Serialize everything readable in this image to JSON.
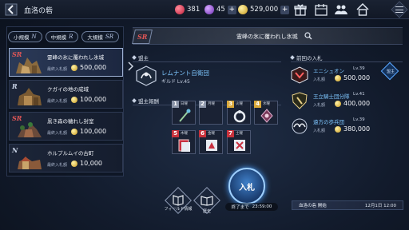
{
  "header": {
    "title": "血洛の砦",
    "resources": [
      {
        "icon": "red-gem-icon",
        "value": "381"
      },
      {
        "icon": "purple-orb-icon",
        "value": "45"
      },
      {
        "icon": "gold-coin-icon",
        "value": "529,000"
      }
    ],
    "icons": [
      "gift-icon",
      "calendar-icon",
      "guild-icon",
      "home-icon",
      "menu-icon"
    ]
  },
  "filters": [
    {
      "label": "小規模",
      "rank": "N"
    },
    {
      "label": "中規模",
      "rank": "R"
    },
    {
      "label": "大規模",
      "rank": "SR"
    }
  ],
  "items": [
    {
      "rank": "SR",
      "name": "霊峰の氷に覆われし氷城",
      "bid_label": "最終入札額",
      "bid": "500,000"
    },
    {
      "rank": "R",
      "name": "クガイの地の成域",
      "bid_label": "最終入札額",
      "bid": "100,000"
    },
    {
      "rank": "SR",
      "name": "黒き森の穢れし封室",
      "bid_label": "最終入札額",
      "bid": "100,000"
    },
    {
      "rank": "N",
      "name": "ホルプルムイの古町",
      "bid_label": "最終入札額",
      "bid": "10,000"
    }
  ],
  "detail": {
    "rank": "SR",
    "title": "霊峰の氷に覆われし氷城",
    "owner_section": "盟主",
    "owner_guild": "レムナント自衛団",
    "owner_guild_level": "ギルド Lv.45",
    "reward_section": "盟主報酬",
    "rewards": [
      {
        "num": "1",
        "tag": "日曜",
        "color": "#8a94a8"
      },
      {
        "num": "2",
        "tag": "月曜",
        "color": "#8a94a8"
      },
      {
        "num": "3",
        "tag": "火曜",
        "color": "#d9a83a"
      },
      {
        "num": "4",
        "tag": "水曜",
        "color": "#d9a83a"
      },
      {
        "num": "5",
        "tag": "木曜",
        "color": "#c8323c"
      },
      {
        "num": "6",
        "tag": "金曜",
        "color": "#c8323c"
      },
      {
        "num": "7",
        "tag": "土曜",
        "color": "#c8323c"
      }
    ]
  },
  "previous_bids": {
    "title": "前回の入札",
    "entries": [
      {
        "name": "エニシュオン",
        "level": "Lv.39",
        "bid_label": "入札額",
        "bid": "500,000",
        "badge": "盟主"
      },
      {
        "name": "王立騎士団分隊",
        "level": "Lv.41",
        "bid_label": "入札額",
        "bid": "400,000"
      },
      {
        "name": "遠方の歩兵団",
        "level": "Lv.39",
        "bid_label": "入札額",
        "bid": "380,000"
      }
    ]
  },
  "actions": {
    "field_info_label": "フィールド情報",
    "history_label": "歴史",
    "bid_button_label": "入札",
    "end_label": "終了まで",
    "end_time": "23:59:00"
  },
  "status": {
    "label": "血洛の砦 開始",
    "time": "12月1日 12:00"
  }
}
